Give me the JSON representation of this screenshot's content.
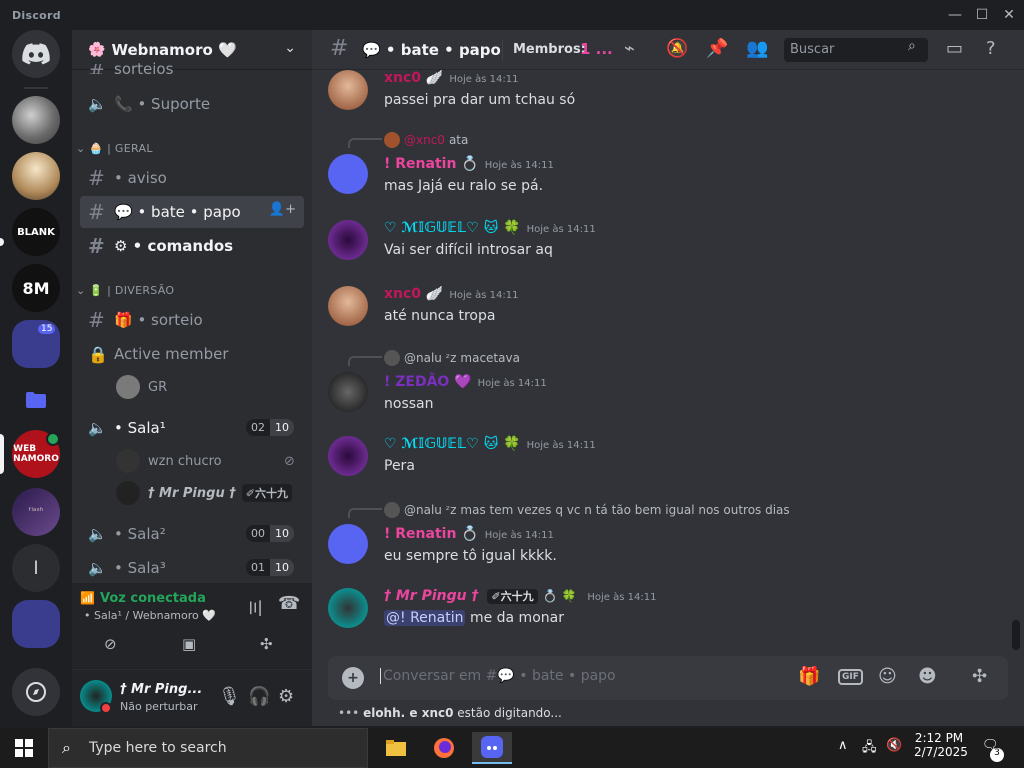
{
  "window": {
    "title": "Discord",
    "minimize": "—",
    "maximize": "☐",
    "close": "✕"
  },
  "server": {
    "name": "Webnamoro 🤍",
    "emblem": "🌸"
  },
  "sidebar": {
    "partial_channel": "sorteios",
    "support_channel": "📞 • Suporte",
    "cat_geral": "| GERAL",
    "cat_geral_emoji": "🧁",
    "cat_diversao": "| DIVERSÃO",
    "cat_diversao_emoji": "🔋",
    "channels": [
      {
        "label": "• aviso"
      },
      {
        "label": "💬 • bate • papo"
      },
      {
        "label": "⚙ • comandos"
      },
      {
        "label": "🎁 • sorteio"
      }
    ],
    "active_member": "Active member",
    "active_member_user": "GR",
    "sala1": {
      "label": "• Sala¹",
      "left": "02",
      "right": "10"
    },
    "sala1_users": [
      {
        "name": "wzn chucro"
      },
      {
        "name": "† Mr Pingu †",
        "tag": "✐六十九"
      }
    ],
    "sala2": {
      "label": "• Sala²",
      "left": "00",
      "right": "10"
    },
    "sala3": {
      "label": "• Sala³",
      "left": "01",
      "right": "10"
    }
  },
  "voice": {
    "status": "Voz conectada",
    "location": "• Sala¹ / Webnamoro 🤍"
  },
  "user": {
    "name": "† Mr Ping...",
    "status": "Não perturbar"
  },
  "guild_badge": "15",
  "header": {
    "channel": "💬 • bate • papo",
    "members_label": "Membros:",
    "members_value": "1 ...",
    "search_placeholder": "Buscar"
  },
  "messages": [
    {
      "author": "xnc0 🪽",
      "time": "Hoje às 14:11",
      "text": "passei pra dar um tchau só"
    },
    {
      "reply_to": "@xnc0",
      "reply_text": "ata",
      "author": "! Renatin 💍",
      "time": "Hoje às 14:11",
      "text": "mas Jajá eu ralo se pá."
    },
    {
      "author": "♡ ℳ𝕀𝔾𝕌𝔼𝕃♡ 🐱 🍀",
      "time": "Hoje às 14:11",
      "text": "Vai ser difícil introsar aq"
    },
    {
      "author": "xnc0 🪽",
      "time": "Hoje às 14:11",
      "text": "até nunca tropa"
    },
    {
      "reply_to": "@nalu ᶻz",
      "reply_text": "macetava",
      "author": "! ZEDÃO 💜",
      "time": "Hoje às 14:11",
      "text": "nossan"
    },
    {
      "author": "♡ ℳ𝕀𝔾𝕌𝔼𝕃♡ 🐱 🍀",
      "time": "Hoje às 14:11",
      "text": "Pera"
    },
    {
      "reply_to": "@nalu ᶻz",
      "reply_text": "mas tem vezes q vc n tá tão bem igual nos outros dias",
      "author": "! Renatin 💍",
      "time": "Hoje às 14:11",
      "text": "eu sempre tô igual kkkk."
    },
    {
      "author": "† Mr Pingu †",
      "tag": "✐六十九",
      "extra": "💍 🍀",
      "time": "Hoje às 14:11",
      "mention": "@! Renatin",
      "text": "me da monar"
    }
  ],
  "composer": {
    "placeholder": "Conversar em #💬 • bate • papo",
    "gif": "GIF"
  },
  "typing": {
    "users": "elohh. e xnc0",
    "suffix": " estão digitando..."
  },
  "taskbar": {
    "search_placeholder": "Type here to search",
    "time": "2:12 PM",
    "date": "2/7/2025",
    "notifications": "3"
  },
  "colors": {
    "accent": "#5865f2",
    "online": "#23a55a",
    "pink": "#eb459f",
    "cyan": "#00e5ff",
    "purple": "#9b59b6"
  }
}
